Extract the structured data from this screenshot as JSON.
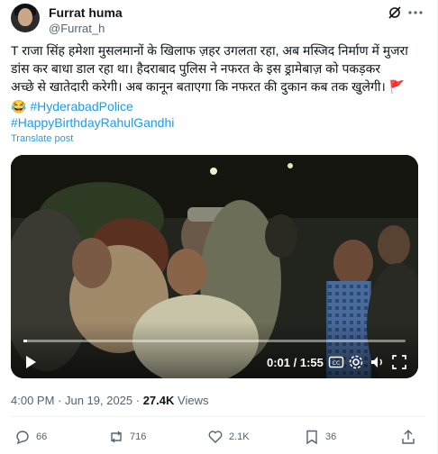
{
  "author": {
    "name": "Furrat huma",
    "handle": "@Furrat_h"
  },
  "post": {
    "line1": "T राजा सिंह हमेशा मुसलमानों के खिलाफ ज़हर उगलता रहा, अब मस्जिद निर्माण में मुजरा",
    "line2": "डांस कर बाधा डाल रहा था। हैदराबाद पुलिस ने नफरत के इस ड्रामेबाज़ को पकड़कर",
    "line3": "अच्छे से खातेदारी  करेगी। अब कानून बताएगा कि नफरत की दुकान कब तक खुलेगी।",
    "flag": "🚩",
    "emoji": "😂",
    "hashtag1": "#HyderabadPolice",
    "hashtag2": "#HappyBirthdayRahulGandhi",
    "translate": "Translate post"
  },
  "video": {
    "time": "0:01 / 1:55",
    "progress": 0.009
  },
  "meta": {
    "timestamp": "4:00 PM · Jun 19, 2025 · ",
    "views_count": "27.4K",
    "views_label": " Views"
  },
  "actions": {
    "replies": "66",
    "reposts": "716",
    "likes": "2.1K",
    "bookmarks": "36"
  },
  "colors": {
    "link": "#1d9bf0",
    "muted": "#536471",
    "text": "#0f1419"
  }
}
